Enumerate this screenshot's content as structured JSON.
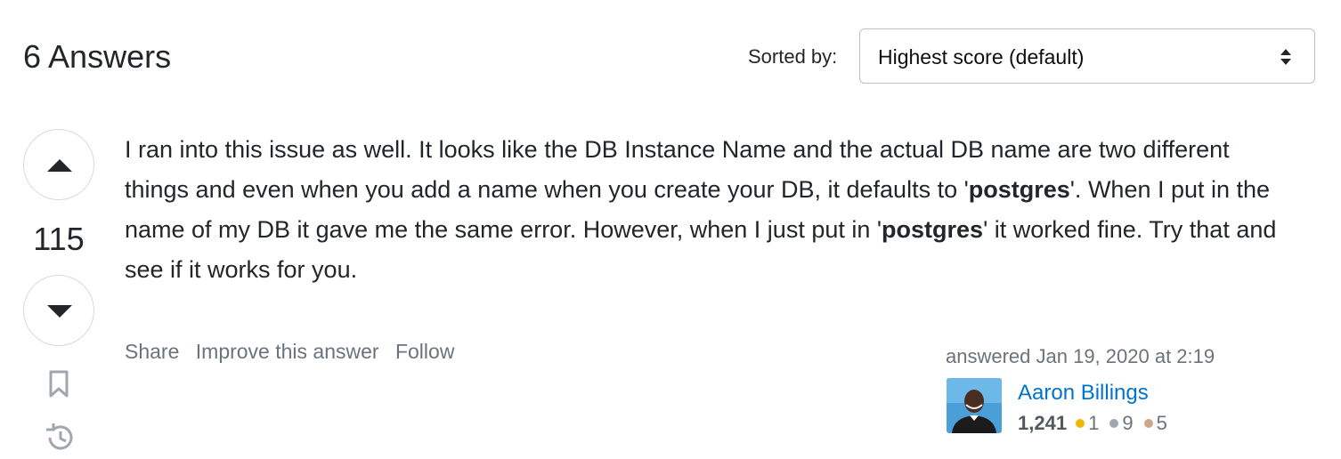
{
  "header": {
    "answers_count_label": "6 Answers",
    "sort_label": "Sorted by:",
    "sort_value": "Highest score (default)"
  },
  "vote": {
    "count": "115"
  },
  "answer": {
    "text_1": "I ran into this issue as well. It looks like the DB Instance Name and the actual DB name are two different things and even when you add a name when you create your DB, it defaults to '",
    "bold_1": "postgres",
    "text_2": "'. When I put in the name of my DB it gave me the same error. However, when I just put in '",
    "bold_2": "postgres",
    "text_3": "' it worked fine. Try that and see if it works for you."
  },
  "post_menu": {
    "share": "Share",
    "improve": "Improve this answer",
    "follow": "Follow"
  },
  "user": {
    "action_time": "answered Jan 19, 2020 at 2:19",
    "name": "Aaron Billings",
    "reputation": "1,241",
    "gold": "1",
    "silver": "9",
    "bronze": "5"
  },
  "colors": {
    "link": "#0074cc",
    "muted": "#6a737c",
    "gold": "#f1b600",
    "silver": "#9fa6ad",
    "bronze": "#d1a684"
  },
  "icons": {
    "vote_up": "arrow-up-icon",
    "vote_down": "arrow-down-icon",
    "bookmark": "bookmark-icon",
    "history": "history-icon",
    "sort": "sort-arrows-icon"
  }
}
